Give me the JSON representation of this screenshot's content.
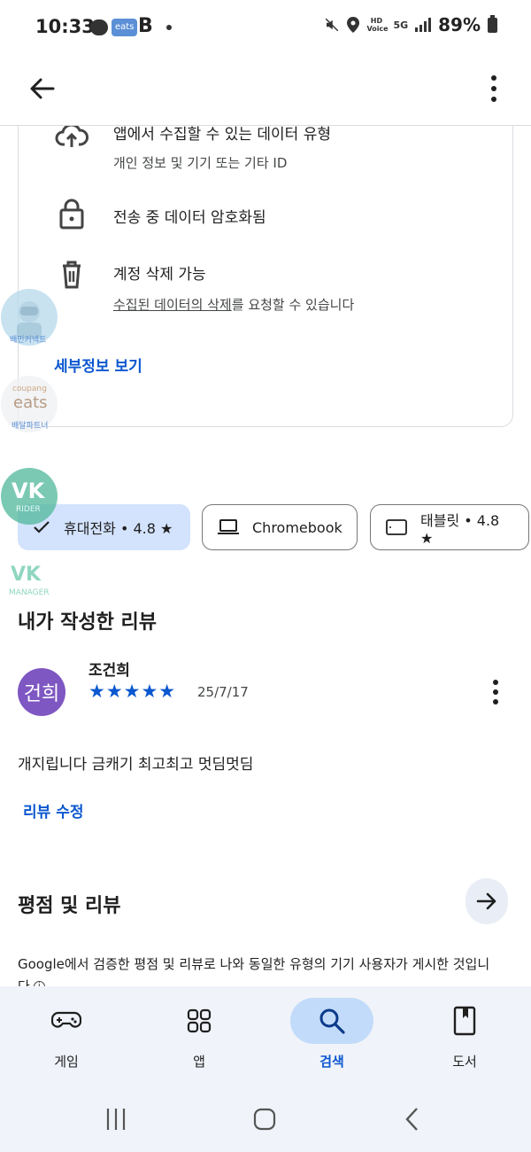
{
  "status_bar": {
    "time": "10:33",
    "eats_badge": "eats",
    "b_badge": "B",
    "hd_voice": "HD Voice",
    "network": "5G",
    "battery": "89%"
  },
  "data_safety": {
    "item1_title": "앱에서 수집할 수 있는 데이터 유형",
    "item1_sub": "개인 정보 및 기기 또는 기타 ID",
    "item2_title": "전송 중 데이터 암호화됨",
    "item3_title": "계정 삭제 가능",
    "item3_sub_link": "수집된 데이터의 삭제",
    "item3_sub_rest": "를 요청할 수 있습니다",
    "details_link": "세부정보 보기"
  },
  "bubbles": {
    "baemin_label": "배민커넥트",
    "coupang_small": "coupang",
    "coupang_big": "eats",
    "coupang_label": "배달파트너",
    "vk_rider_logo": "VK",
    "vk_rider_label": "RIDER",
    "vk_manager_logo": "VK",
    "vk_manager_label": "MANAGER"
  },
  "device_chips": {
    "phone": "휴대전화 • 4.8 ★",
    "chromebook": "Chromebook",
    "tablet": "태블릿 • 4.8 ★"
  },
  "my_review": {
    "section_title": "내가 작성한 리뷰",
    "avatar_text": "건희",
    "reviewer": "조건희",
    "rating": 5,
    "stars": "★★★★★",
    "date": "25/7/17",
    "text": "개지립니다 금캐기 최고최고 멋딤멋딤",
    "edit_label": "리뷰 수정"
  },
  "ratings": {
    "section_title": "평점 및 리뷰",
    "description": "Google에서 검증한 평점 및 리뷰로 나와 동일한 유형의 기기 사용자가 게시한 것입니다"
  },
  "bottom_nav": {
    "games": "게임",
    "apps": "앱",
    "search": "검색",
    "books": "도서"
  },
  "colors": {
    "accent": "#0b57d0",
    "chip_selected": "#d3e3fd",
    "nav_active": "#c2dbfa",
    "avatar": "#7e57c2",
    "bubble_teal": "#4fb89a"
  }
}
